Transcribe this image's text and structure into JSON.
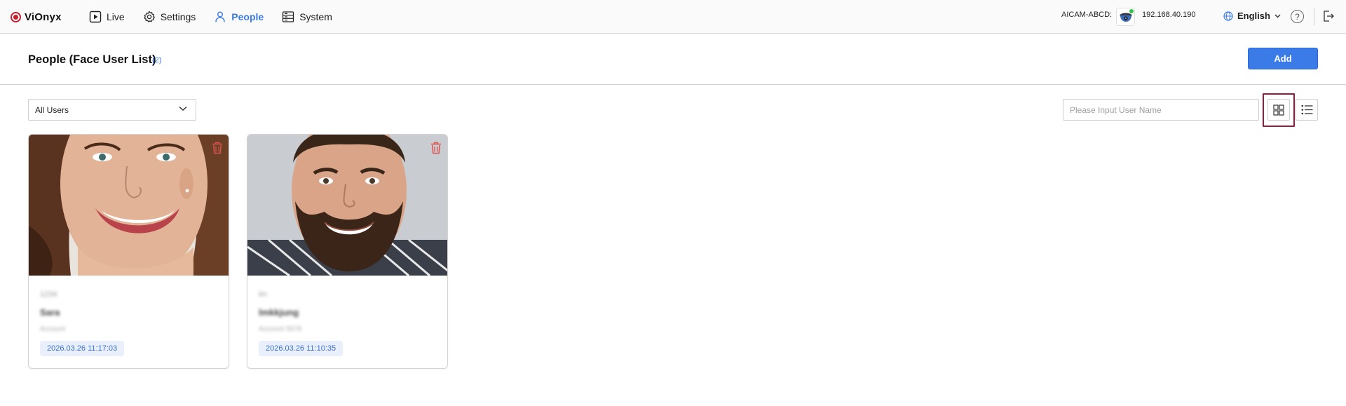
{
  "app": {
    "name": "ViOnyx"
  },
  "nav": [
    {
      "label": "Live",
      "icon": "play-icon",
      "active": false
    },
    {
      "label": "Settings",
      "icon": "gear-icon",
      "active": false
    },
    {
      "label": "People",
      "icon": "person-icon",
      "active": true
    },
    {
      "label": "System",
      "icon": "server-icon",
      "active": false
    }
  ],
  "device": {
    "label": "AICAM-ABCD:",
    "ip": "192.168.40.190"
  },
  "language": {
    "selected": "English"
  },
  "page": {
    "title": "People (Face User List)",
    "count": "(2)",
    "add_label": "Add"
  },
  "filter": {
    "selected": "All Users"
  },
  "search": {
    "placeholder": "Please Input User Name",
    "value": ""
  },
  "view": {
    "mode": "grid"
  },
  "users": [
    {
      "id": "1234",
      "name": "Sara",
      "account": "Account",
      "date": "2026.03.26 11:17:03"
    },
    {
      "id": "lm",
      "name": "lmkkjung",
      "account": "Account 5678",
      "date": "2026.03.26 11:10:35"
    }
  ],
  "colors": {
    "accent": "#3b7be8",
    "danger": "#d9534f",
    "highlight": "#9a1a3c"
  }
}
